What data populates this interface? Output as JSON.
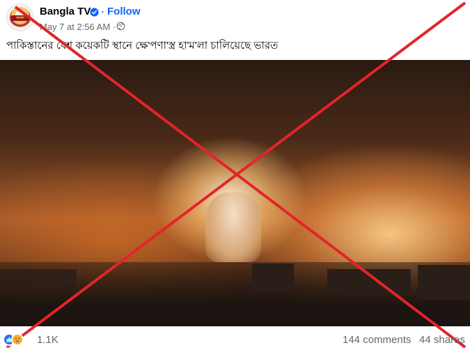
{
  "post": {
    "page_name": "Bangla TV",
    "follow_label": "Follow",
    "timestamp": "May 7 at 2:56 AM",
    "separator": "·",
    "caption": "পাকিস্তানের বেশ কয়েকটি স্থানে ক্ষে'পণা'স্ত্র হা'ম'লা চালিয়েছে ভারত",
    "avatar_text": "বাংলা"
  },
  "icons": {
    "verified": "verified-badge-icon",
    "audience": "globe-icon",
    "reaction_like": "like-reaction-icon",
    "reaction_care": "care-reaction-icon"
  },
  "engagement": {
    "reactions": "1.1K",
    "comments": "144 comments",
    "shares": "44 shares"
  },
  "overlay": {
    "type": "red-cross",
    "color": "#e3242b"
  },
  "colors": {
    "accent": "#0866ff",
    "muted": "#65676b",
    "text": "#050505"
  }
}
